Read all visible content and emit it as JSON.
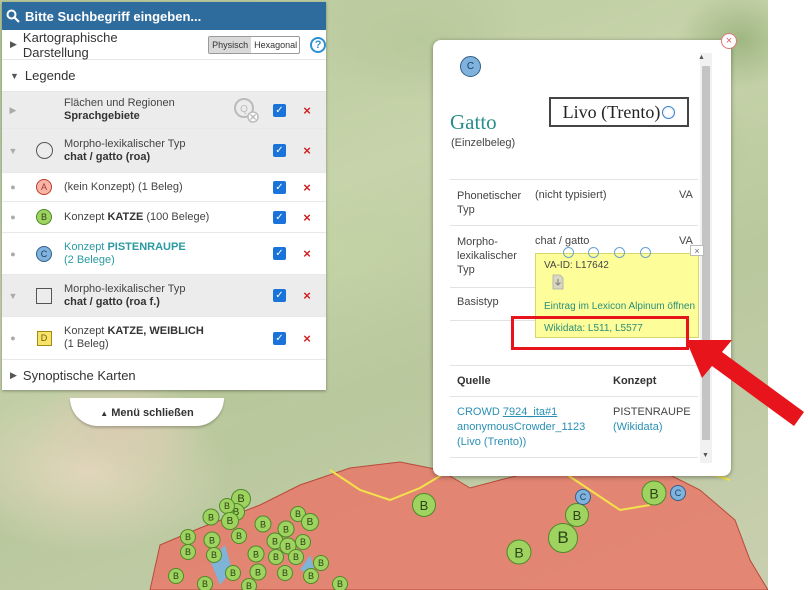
{
  "search": {
    "placeholder": "Bitte Suchbegriff eingeben..."
  },
  "display": {
    "label": "Kartographische Darstellung",
    "options": [
      "Physisch",
      "Hexagonal"
    ],
    "selected": "Physisch",
    "help": "?"
  },
  "legend": {
    "label": "Legende",
    "items": [
      {
        "line1": "Flächen und Regionen",
        "line2": "Sprachgebiete"
      },
      {
        "line1": "Morpho-lexikalischer Typ",
        "line2": "chat / gatto (roa)"
      },
      {
        "symbol": "A",
        "text": "(kein Konzept) (1 Beleg)"
      },
      {
        "symbol": "B",
        "prefix": "Konzept",
        "concept": "KATZE",
        "suffix": "(100 Belege)"
      },
      {
        "symbol": "C",
        "prefix": "Konzept",
        "concept": "PISTENRAUPE",
        "suffix": "(2 Belege)"
      },
      {
        "line1": "Morpho-lexikalischer Typ",
        "line2": "chat / gatto (roa f.)"
      },
      {
        "symbol": "D",
        "prefix": "Konzept",
        "concept": "KATZE, WEIBLICH",
        "suffix": "(1 Beleg)"
      }
    ],
    "check": "✓",
    "remove": "×"
  },
  "synoptic": {
    "label": "Synoptische Karten"
  },
  "menu_close": {
    "label": "Menü schließen"
  },
  "popup": {
    "badge": "C",
    "title": "Gatto",
    "subtitle": "(Einzelbeleg)",
    "location": "Livo (Trento)",
    "close": "×",
    "rows": [
      {
        "label": "Phonetischer Typ",
        "value": "(nicht typisiert)",
        "tag": "VA"
      },
      {
        "label": "Morpho-lexikalischer Typ",
        "value": "chat / gatto",
        "tag": "VA"
      },
      {
        "label": "Basistyp",
        "value": "",
        "tag": ""
      }
    ],
    "tooltip": {
      "va_id": "VA-ID: L17642",
      "lexicon_link": "Eintrag im Lexicon Alpinum öffnen",
      "wikidata": "Wikidata: L511, L5577",
      "close": "×"
    },
    "table": {
      "headers": [
        "Quelle",
        "Konzept"
      ],
      "source_prefix": "CROWD",
      "source_id": "7924_ita#1",
      "source_user": "anonymousCrowder_1123",
      "source_place": "(Livo (Trento))",
      "concept": "PISTENRAUPE",
      "concept_link": "(Wikidata)"
    }
  },
  "map": {
    "bubble_label_b": "B",
    "bubble_label_c": "C"
  },
  "colors": {
    "header": "#2f6c9e",
    "region_fill": "#e8796a",
    "bubble_b": "#9ed35f",
    "bubble_c": "#7fb2dc",
    "tooltip": "#fdfd9a",
    "highlight": "#e8141c"
  }
}
